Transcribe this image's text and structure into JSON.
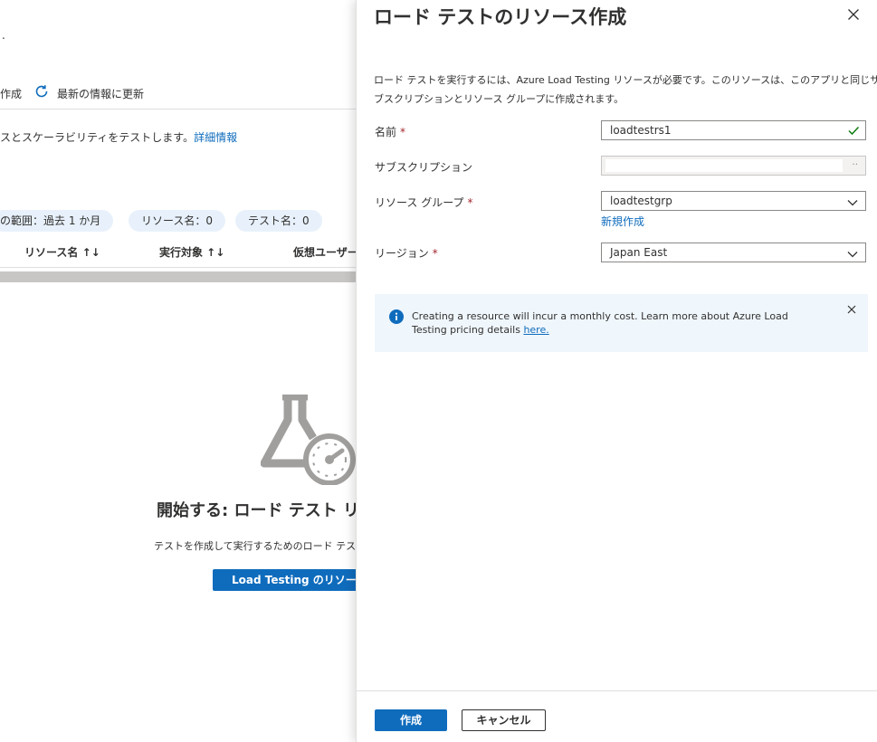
{
  "background": {
    "dot": ".",
    "toolbar": {
      "create_label": "作成",
      "refresh_label": "最新の情報に更新"
    },
    "description": "スとスケーラビリティをテストします。",
    "learn_more": "詳細情報",
    "filters": [
      "の範囲：過去 1 か月",
      "リソース名：0",
      "テスト名：0"
    ],
    "columns": [
      "リソース名 ↑↓",
      "実行対象 ↑↓",
      "仮想ユーザー"
    ],
    "empty_title": "開始する: ロード テスト リソ",
    "empty_desc": "テストを作成して実行するためのロード テスト",
    "empty_button": "Load Testing のリソースの"
  },
  "panel": {
    "title": "ロード テストのリソース作成",
    "intro": "ロード テストを実行するには、Azure Load Testing リソースが必要です。このリソースは、このアプリと同じサブスクリプションとリソース グループに作成されます。",
    "intro_line1": "ロード テストを実行するには、Azure Load Testing リソースが必要です。このリソースは、このアプリと同じサ",
    "intro_line2": "ブスクリプションとリソース グループに作成されます。",
    "fields": {
      "name_label": "名前",
      "name_value": "loadtestrs1",
      "subscription_label": "サブスクリプション",
      "subscription_value": "",
      "resource_group_label": "リソース グループ",
      "resource_group_value": "loadtestgrp",
      "new_link": "新規作成",
      "region_label": "リージョン",
      "region_value": "Japan East"
    },
    "required_mark": "*",
    "info": {
      "line1": "Creating a resource will incur a monthly cost. Learn more about Azure Load",
      "line2_prefix": "Testing pricing details ",
      "link": "here."
    },
    "create_button": "作成",
    "cancel_button": "キャンセル"
  },
  "colors": {
    "accent": "#0f6cbd",
    "info_bg": "#eff6fc",
    "required": "#a4262c",
    "valid": "#107c10"
  }
}
